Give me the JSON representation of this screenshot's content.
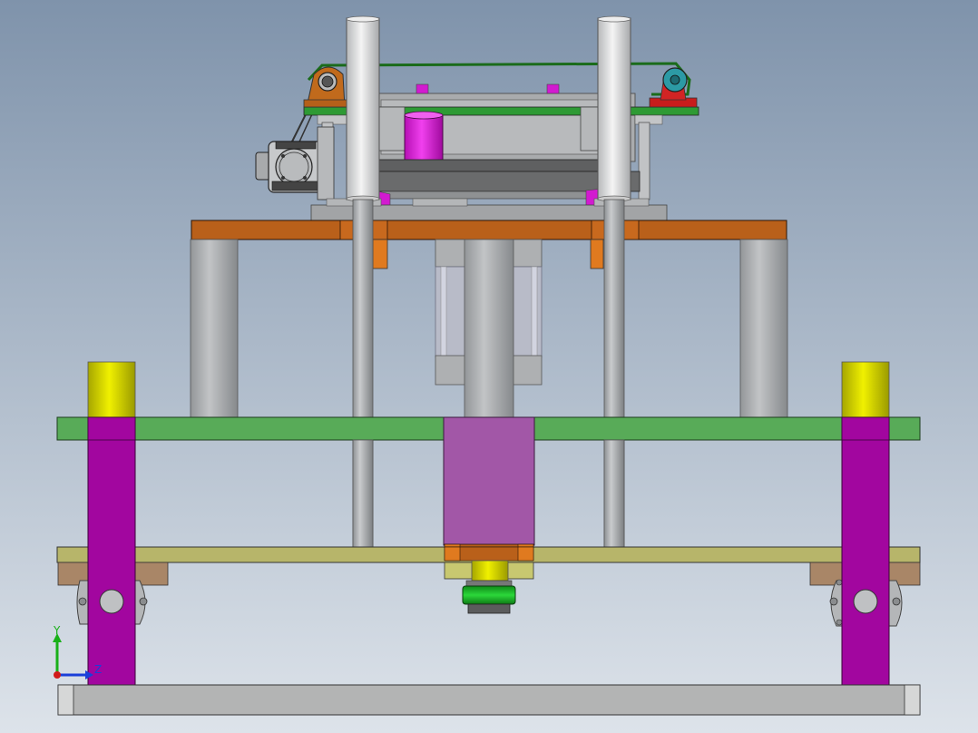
{
  "viewport": {
    "background_top": "#7f93ab",
    "background_bottom": "#dde3ea"
  },
  "colors": {
    "steel_light": "#b4b6b8",
    "steel_mid": "#9ea1a4",
    "steel_dark": "#7d8083",
    "orange_plate": "#b9601a",
    "orange_bright": "#e07a1f",
    "green_plate": "#58ab58",
    "olive_plate": "#b7b56a",
    "magenta": "#a2069f",
    "purple_block": "#a257a7",
    "yellow_cap": "#c8c800",
    "tan_bracket": "#a98667",
    "red_part": "#c81c1c",
    "teal": "#2c9aa5",
    "green_pulley": "#1fb52a",
    "dark_gray": "#5e5f60"
  },
  "triad": {
    "y_label": "Y",
    "z_label": "Z",
    "y_color": "#19b019",
    "z_color": "#1a3fd9",
    "x_color": "#d11a1a"
  }
}
